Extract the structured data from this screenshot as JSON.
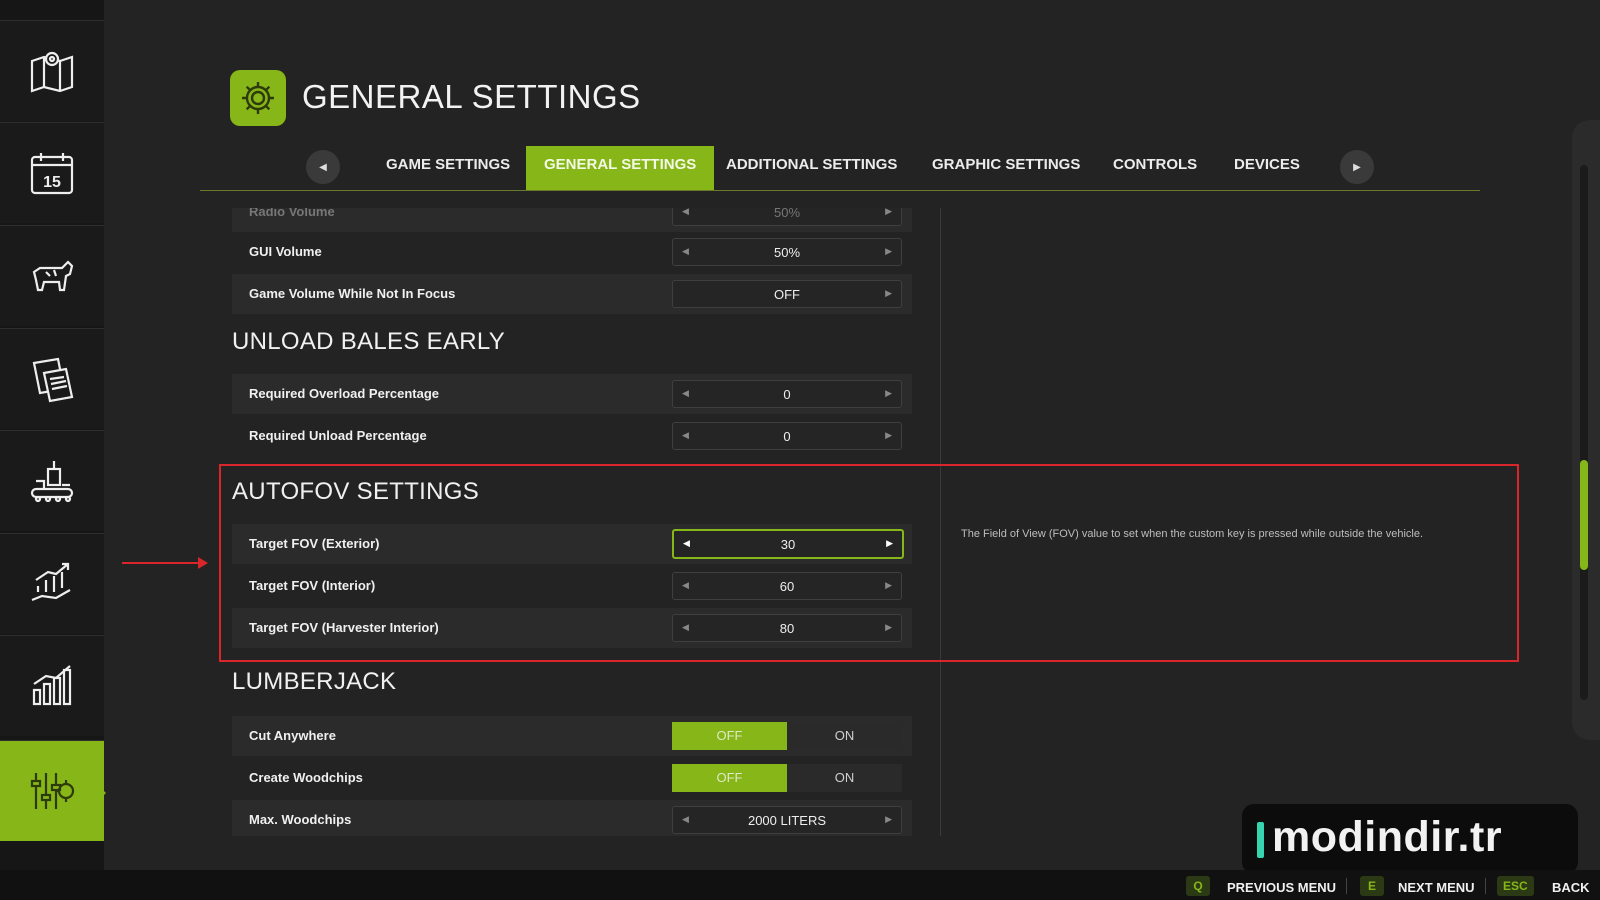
{
  "header": {
    "title": "GENERAL SETTINGS",
    "icon": "gear-icon"
  },
  "sidebar": {
    "items": [
      {
        "icon": "map-icon"
      },
      {
        "icon": "calendar-icon",
        "badge": "15"
      },
      {
        "icon": "cow-icon"
      },
      {
        "icon": "documents-icon"
      },
      {
        "icon": "production-icon"
      },
      {
        "icon": "finance-icon"
      },
      {
        "icon": "statistics-icon"
      },
      {
        "icon": "settings-sliders-icon",
        "active": true
      }
    ]
  },
  "tabs": [
    {
      "label": "GAME SETTINGS"
    },
    {
      "label": "GENERAL SETTINGS",
      "active": true
    },
    {
      "label": "ADDITIONAL SETTINGS"
    },
    {
      "label": "GRAPHIC SETTINGS"
    },
    {
      "label": "CONTROLS"
    },
    {
      "label": "DEVICES"
    }
  ],
  "settings": {
    "partial": {
      "label": "Radio Volume",
      "value": "50%"
    },
    "gui_volume": {
      "label": "GUI Volume",
      "value": "50%"
    },
    "game_volume_focus": {
      "label": "Game Volume While Not In Focus",
      "value": "OFF"
    },
    "unload_section": "UNLOAD BALES EARLY",
    "overload_pct": {
      "label": "Required Overload Percentage",
      "value": "0"
    },
    "unload_pct": {
      "label": "Required Unload Percentage",
      "value": "0"
    },
    "autofov_section": "AUTOFOV SETTINGS",
    "fov_exterior": {
      "label": "Target FOV (Exterior)",
      "value": "30"
    },
    "fov_interior": {
      "label": "Target FOV (Interior)",
      "value": "60"
    },
    "fov_harvester": {
      "label": "Target FOV (Harvester Interior)",
      "value": "80"
    },
    "lumberjack_section": "LUMBERJACK",
    "cut_anywhere": {
      "label": "Cut Anywhere",
      "off": "OFF",
      "on": "ON"
    },
    "create_woodchips": {
      "label": "Create Woodchips",
      "off": "OFF",
      "on": "ON"
    },
    "max_woodchips": {
      "label": "Max. Woodchips",
      "value": "2000 LITERS"
    }
  },
  "description": "The Field of View (FOV) value to set when the custom key is pressed while outside the vehicle.",
  "footer": {
    "prev_key": "Q",
    "prev_label": "PREVIOUS MENU",
    "next_key": "E",
    "next_label": "NEXT MENU",
    "back_key": "ESC",
    "back_label": "BACK"
  },
  "watermark": "modindir.tr",
  "colors": {
    "accent": "#86b618",
    "highlight": "#d8262b",
    "background": "#232323"
  }
}
